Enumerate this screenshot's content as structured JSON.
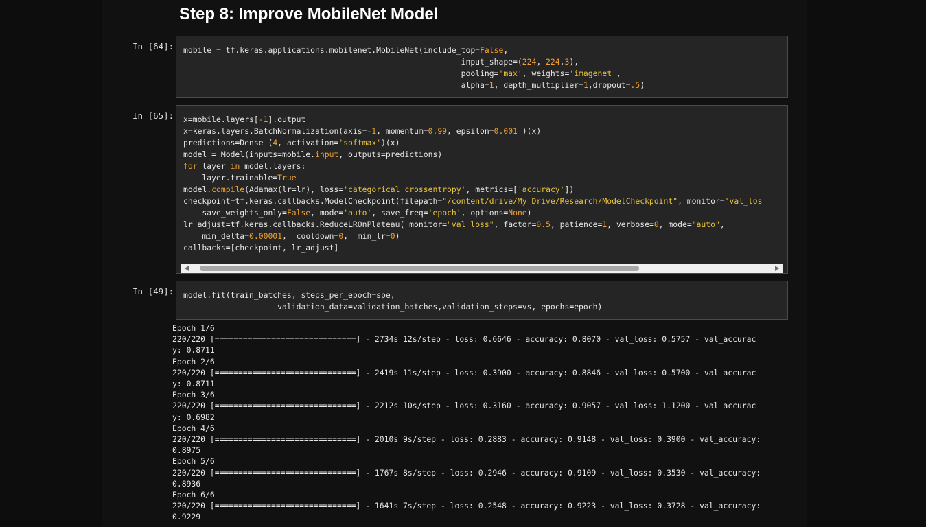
{
  "heading": "Step 8: Improve MobileNet Model",
  "cells": [
    {
      "prompt": "In [64]:",
      "lines": [
        [
          {
            "t": "mobile = tf.keras.applications.mobilenet.MobileNet(include_top=",
            "c": "k"
          },
          {
            "t": "False",
            "c": "n"
          },
          {
            "t": ",",
            "c": "k"
          }
        ],
        [
          {
            "t": "                                                           input_shape=(",
            "c": "k"
          },
          {
            "t": "224",
            "c": "n"
          },
          {
            "t": ", ",
            "c": "k"
          },
          {
            "t": "224",
            "c": "n"
          },
          {
            "t": ",",
            "c": "k"
          },
          {
            "t": "3",
            "c": "n"
          },
          {
            "t": "),",
            "c": "k"
          }
        ],
        [
          {
            "t": "                                                           pooling=",
            "c": "k"
          },
          {
            "t": "'max'",
            "c": "s"
          },
          {
            "t": ", weights=",
            "c": "k"
          },
          {
            "t": "'imagenet'",
            "c": "s"
          },
          {
            "t": ",",
            "c": "k"
          }
        ],
        [
          {
            "t": "                                                           alpha=",
            "c": "k"
          },
          {
            "t": "1",
            "c": "n"
          },
          {
            "t": ", depth_multiplier=",
            "c": "k"
          },
          {
            "t": "1",
            "c": "n"
          },
          {
            "t": ",dropout=",
            "c": "k"
          },
          {
            "t": ".5",
            "c": "n"
          },
          {
            "t": ")",
            "c": "k"
          }
        ]
      ]
    },
    {
      "prompt": "In [65]:",
      "lines": [
        [
          {
            "t": "x=mobile.layers[",
            "c": "k"
          },
          {
            "t": "-1",
            "c": "n"
          },
          {
            "t": "].output",
            "c": "k"
          }
        ],
        [
          {
            "t": "x=keras.layers.BatchNormalization(axis=",
            "c": "k"
          },
          {
            "t": "-1",
            "c": "n"
          },
          {
            "t": ", momentum=",
            "c": "k"
          },
          {
            "t": "0.99",
            "c": "n"
          },
          {
            "t": ", epsilon=",
            "c": "k"
          },
          {
            "t": "0.001",
            "c": "n"
          },
          {
            "t": " )(x)",
            "c": "k"
          }
        ],
        [
          {
            "t": "predictions=Dense (",
            "c": "k"
          },
          {
            "t": "4",
            "c": "n"
          },
          {
            "t": ", activation=",
            "c": "k"
          },
          {
            "t": "'softmax'",
            "c": "s"
          },
          {
            "t": ")(x)",
            "c": "k"
          }
        ],
        [
          {
            "t": "model = Model(inputs=mobile.",
            "c": "k"
          },
          {
            "t": "input",
            "c": "n"
          },
          {
            "t": ", outputs=predictions)",
            "c": "k"
          }
        ],
        [
          {
            "t": "for",
            "c": "n"
          },
          {
            "t": " layer ",
            "c": "k"
          },
          {
            "t": "in",
            "c": "n"
          },
          {
            "t": " model.layers:",
            "c": "k"
          }
        ],
        [
          {
            "t": "    layer.trainable=",
            "c": "k"
          },
          {
            "t": "True",
            "c": "n"
          }
        ],
        [
          {
            "t": "model.",
            "c": "k"
          },
          {
            "t": "compile",
            "c": "n"
          },
          {
            "t": "(Adamax(lr=lr), loss=",
            "c": "k"
          },
          {
            "t": "'categorical_crossentropy'",
            "c": "s"
          },
          {
            "t": ", metrics=[",
            "c": "k"
          },
          {
            "t": "'accuracy'",
            "c": "s"
          },
          {
            "t": "])",
            "c": "k"
          }
        ],
        [
          {
            "t": "checkpoint=tf.keras.callbacks.ModelCheckpoint(filepath=",
            "c": "k"
          },
          {
            "t": "\"/content/drive/My Drive/Research/ModelCheckpoint\"",
            "c": "s"
          },
          {
            "t": ", monitor=",
            "c": "k"
          },
          {
            "t": "'val_los",
            "c": "s"
          }
        ],
        [
          {
            "t": "    save_weights_only=",
            "c": "k"
          },
          {
            "t": "False",
            "c": "n"
          },
          {
            "t": ", mode=",
            "c": "k"
          },
          {
            "t": "'auto'",
            "c": "s"
          },
          {
            "t": ", save_freq=",
            "c": "k"
          },
          {
            "t": "'epoch'",
            "c": "s"
          },
          {
            "t": ", options=",
            "c": "k"
          },
          {
            "t": "None",
            "c": "n"
          },
          {
            "t": ")",
            "c": "k"
          }
        ],
        [
          {
            "t": "lr_adjust=tf.keras.callbacks.ReduceLROnPlateau( monitor=",
            "c": "k"
          },
          {
            "t": "\"val_loss\"",
            "c": "s"
          },
          {
            "t": ", factor=",
            "c": "k"
          },
          {
            "t": "0.5",
            "c": "n"
          },
          {
            "t": ", patience=",
            "c": "k"
          },
          {
            "t": "1",
            "c": "n"
          },
          {
            "t": ", verbose=",
            "c": "k"
          },
          {
            "t": "0",
            "c": "n"
          },
          {
            "t": ", mode=",
            "c": "k"
          },
          {
            "t": "\"auto\"",
            "c": "s"
          },
          {
            "t": ",",
            "c": "k"
          }
        ],
        [
          {
            "t": "    min_delta=",
            "c": "k"
          },
          {
            "t": "0.00001",
            "c": "n"
          },
          {
            "t": ",  cooldown=",
            "c": "k"
          },
          {
            "t": "0",
            "c": "n"
          },
          {
            "t": ",  min_lr=",
            "c": "k"
          },
          {
            "t": "0",
            "c": "n"
          },
          {
            "t": ")",
            "c": "k"
          }
        ],
        [
          {
            "t": "callbacks=[checkpoint, lr_adjust]",
            "c": "k"
          }
        ]
      ]
    },
    {
      "prompt": "In [49]:",
      "lines": [
        [
          {
            "t": "model.fit(train_batches, steps_per_epoch=spe,",
            "c": "k"
          }
        ],
        [
          {
            "t": "                    validation_data=validation_batches,validation_steps=vs, epochs=epoch)",
            "c": "k"
          }
        ]
      ]
    }
  ],
  "output_lines": [
    "Epoch 1/6",
    "220/220 [==============================] - 2734s 12s/step - loss: 0.6646 - accuracy: 0.8070 - val_loss: 0.5757 - val_accurac",
    "y: 0.8711",
    "Epoch 2/6",
    "220/220 [==============================] - 2419s 11s/step - loss: 0.3900 - accuracy: 0.8846 - val_loss: 0.5700 - val_accurac",
    "y: 0.8711",
    "Epoch 3/6",
    "220/220 [==============================] - 2212s 10s/step - loss: 0.3160 - accuracy: 0.9057 - val_loss: 1.1200 - val_accurac",
    "y: 0.6982",
    "Epoch 4/6",
    "220/220 [==============================] - 2010s 9s/step - loss: 0.2883 - accuracy: 0.9148 - val_loss: 0.3900 - val_accuracy:",
    "0.8975",
    "Epoch 5/6",
    "220/220 [==============================] - 1767s 8s/step - loss: 0.2946 - accuracy: 0.9109 - val_loss: 0.3530 - val_accuracy:",
    "0.8936",
    "Epoch 6/6",
    "220/220 [==============================] - 1641s 7s/step - loss: 0.2548 - accuracy: 0.9223 - val_loss: 0.3728 - val_accuracy:",
    "0.9229"
  ]
}
